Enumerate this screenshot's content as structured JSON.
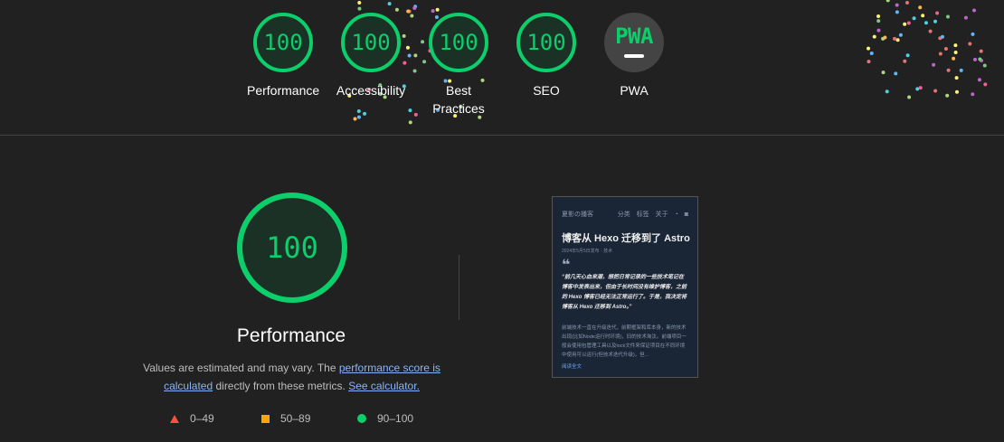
{
  "gauges": [
    {
      "score": "100",
      "label": "Performance"
    },
    {
      "score": "100",
      "label": "Accessibility"
    },
    {
      "score": "100",
      "label": "Best Practices"
    },
    {
      "score": "100",
      "label": "SEO"
    },
    {
      "badge": "PWA",
      "label": "PWA"
    }
  ],
  "performance": {
    "score": "100",
    "title": "Performance",
    "desc_prefix": "Values are estimated and may vary. The ",
    "score_link": "performance score is calculated",
    "desc_middle": " directly from these metrics. ",
    "calc_link": "See calculator."
  },
  "legend": {
    "fail": "0–49",
    "average": "50–89",
    "pass": "90–100"
  },
  "colors": {
    "pass": "#0cce6b",
    "average": "#ffa400",
    "fail": "#ff4e42",
    "link": "#8ab4f8",
    "background": "#212121"
  },
  "thumbnail": {
    "site_name": "夏影の播客",
    "nav": [
      "分类",
      "标签",
      "关于"
    ],
    "title": "博客从 Hexo 迁移到了 Astro",
    "meta": "2024年5月5日发布 · 技术",
    "quote_mark": "❝",
    "quote": "“前几天心血来潮，想把日常记录的一些技术笔记在博客中发表出来，但由于长时间没有维护博客，之前的 Hexo 博客已经无法正常运行了。于是，我决定将博客从 Hexo 迁移到 Astro。”",
    "body": "前端技术一直在升级迭代，前期框架和库本身，新的技术出现(比如Node运行时环境)，旧的技术淘汰。前端项目一般会使用包管理工具以及lock文件来保证项目在不同环境中使用可以运行(但技术迭代升级)，但...",
    "read_more": "阅读全文"
  }
}
